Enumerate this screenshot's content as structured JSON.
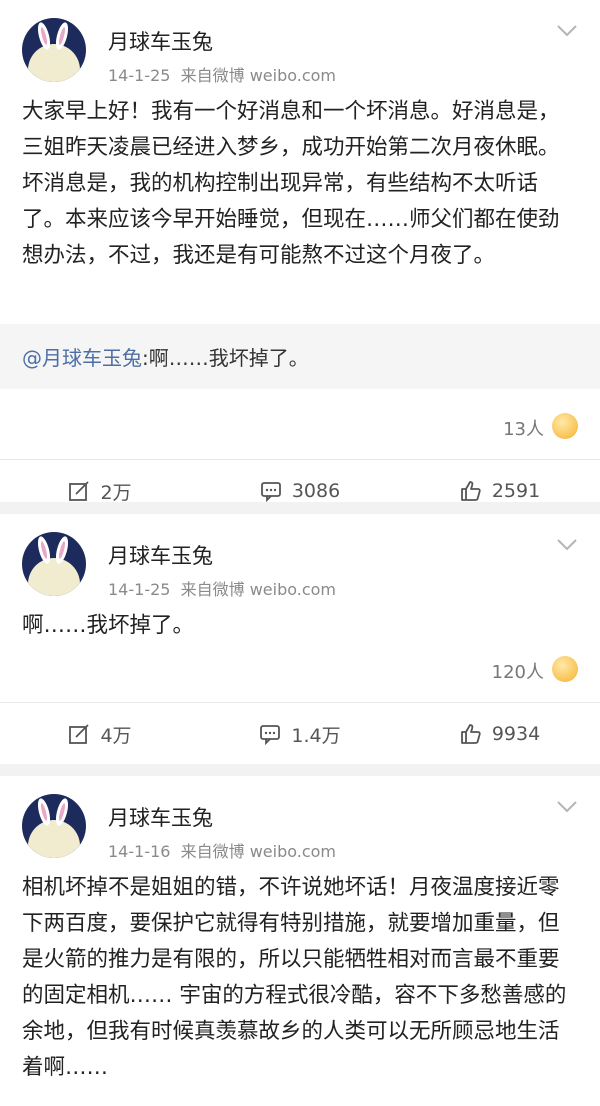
{
  "posts": [
    {
      "author": "月球车玉兔",
      "date": "14-1-25",
      "source": "来自微博 weibo.com",
      "text": "大家早上好！我有一个好消息和一个坏消息。好消息是，三姐昨天凌晨已经进入梦乡，成功开始第二次月夜休眠。坏消息是，我的机构控制出现异常，有些结构不太听话了。本来应该今早开始睡觉，但现在……师父们都在使劲想办法，不过，我还是有可能熬不过这个月夜了。",
      "retweet": {
        "mention": "@月球车玉兔",
        "text": ":啊……我坏掉了。"
      },
      "like_people": "13人",
      "actions": {
        "repost": "2万",
        "comment": "3086",
        "like": "2591"
      }
    },
    {
      "author": "月球车玉兔",
      "date": "14-1-25",
      "source": "来自微博 weibo.com",
      "text": "啊……我坏掉了。",
      "like_people": "120人",
      "actions": {
        "repost": "4万",
        "comment": "1.4万",
        "like": "9934"
      }
    },
    {
      "author": "月球车玉兔",
      "date": "14-1-16",
      "source": "来自微博 weibo.com",
      "text": "相机坏掉不是姐姐的错，不许说她坏话！月夜温度接近零下两百度，要保护它就得有特别措施，就要增加重量，但是火箭的推力是有限的，所以只能牺牲相对而言最不重要的固定相机…… 宇宙的方程式很冷酷，容不下多愁善感的余地，但我有时候真羡慕故乡的人类可以无所顾忌地生活着啊……"
    }
  ],
  "colors": {
    "mention": "#4e6fa6",
    "background": "#f2f2f2"
  }
}
